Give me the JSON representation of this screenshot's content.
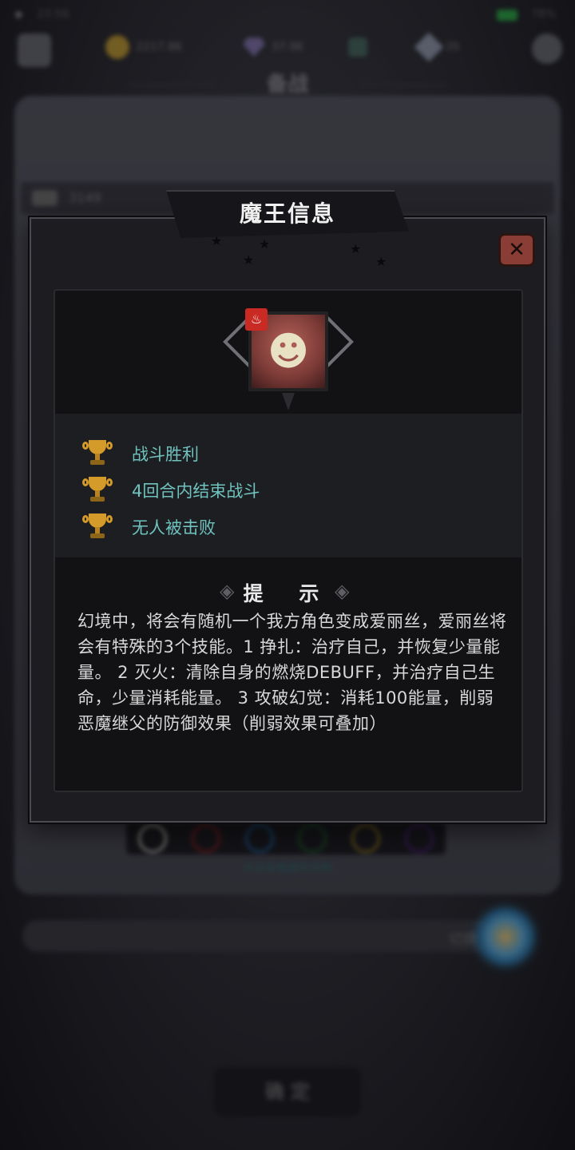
{
  "status_bar": {
    "time": "23:58",
    "battery": "78%"
  },
  "resources": {
    "gold": "2217.8K",
    "gems": "37.9K",
    "stamina": "35"
  },
  "background": {
    "page_title": "备战",
    "row_label": "3149",
    "hint_line": "点击查看属性克制",
    "input_label": "切换",
    "confirm_label": "确 定"
  },
  "modal": {
    "title": "魔王信息",
    "close_icon": "close-x-icon",
    "boss": {
      "portrait_icon": "demon-boss-icon",
      "element_badge_icon": "fire-icon",
      "element_color": "#c92a24"
    },
    "goals": [
      {
        "icon": "trophy-icon",
        "text": "战斗胜利"
      },
      {
        "icon": "trophy-icon",
        "text": "4回合内结束战斗"
      },
      {
        "icon": "trophy-icon",
        "text": "无人被击败"
      }
    ],
    "tips": {
      "heading": "提 示",
      "body": "幻境中，将会有随机一个我方角色变成爱丽丝，爱丽丝将会有特殊的3个技能。1 挣扎：治疗自己，并恢复少量能量。  2 灭火：清除自身的燃烧DEBUFF，并治疗自己生命，少量消耗能量。 3 攻破幻觉：消耗100能量，削弱恶魔继父的防御效果（削弱效果可叠加）"
    }
  },
  "colors": {
    "goal_text": "#6fc2bd",
    "close_button": "#8a3d34",
    "trophy": "#d49a2a"
  }
}
